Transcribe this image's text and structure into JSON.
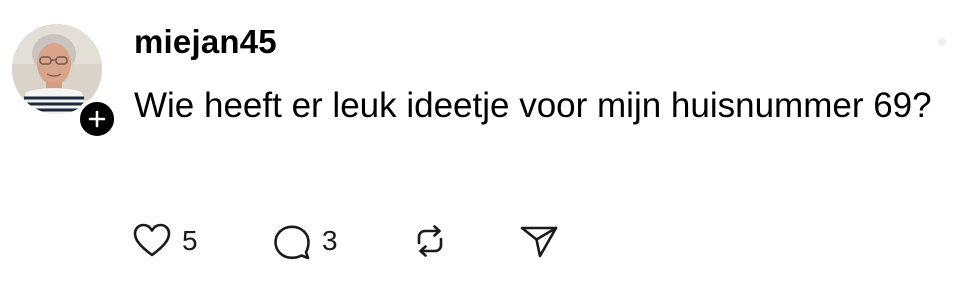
{
  "post": {
    "username": "miejan45",
    "text": "Wie heeft er leuk ideetje voor mijn huisnummer 69?",
    "avatar_icon": "user-avatar-photo",
    "follow_icon": "plus-icon"
  },
  "actions": {
    "like": {
      "icon": "heart-icon",
      "count": "5"
    },
    "comment": {
      "icon": "comment-bubble-icon",
      "count": "3"
    },
    "repost": {
      "icon": "repost-icon"
    },
    "share": {
      "icon": "send-icon"
    }
  },
  "colors": {
    "text": "#000000",
    "background": "#ffffff",
    "badge": "#000000",
    "icon_stroke": "#1a1a1a"
  }
}
